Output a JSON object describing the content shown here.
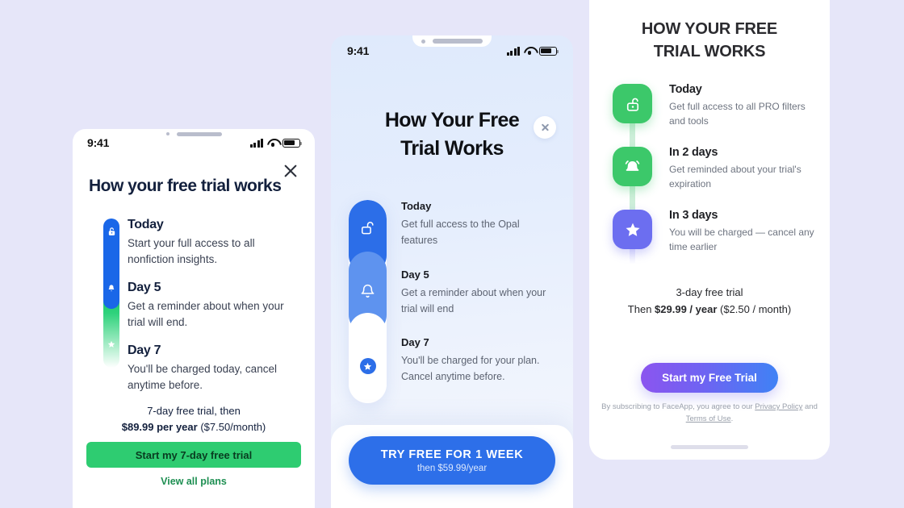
{
  "background_color": "#e6e6f9",
  "panel1": {
    "name": "blinkist-style-trial-screen",
    "status_bar": {
      "time": "9:41",
      "icons": [
        "signal-icon",
        "wifi-icon",
        "battery-icon"
      ]
    },
    "close_icon": "close-icon",
    "title": "How your free trial works",
    "accent_color": "#1a67e8",
    "success_color": "#2ecc71",
    "steps": [
      {
        "icon": "unlock-icon",
        "title": "Today",
        "desc": "Start your full access to all nonfiction insights."
      },
      {
        "icon": "bell-icon",
        "title": "Day 5",
        "desc": "Get a reminder about when your trial will end."
      },
      {
        "icon": "star-icon",
        "title": "Day 7",
        "desc": "You'll be charged today, cancel anytime before."
      }
    ],
    "price_line1": "7-day free trial, then",
    "price_amount": "$89.99 per year",
    "price_suffix": " ($7.50/month)",
    "cta_label": "Start my 7-day free trial",
    "secondary_link": "View all plans"
  },
  "panel2": {
    "name": "opal-style-trial-screen",
    "status_bar": {
      "time": "9:41",
      "icons": [
        "signal-icon",
        "wifi-icon",
        "battery-icon"
      ]
    },
    "close_icon": "close-icon",
    "title_line1": "How Your Free",
    "title_line2": "Trial Works",
    "accent_color": "#2d6fe9",
    "steps": [
      {
        "icon": "unlock-icon",
        "title": "Today",
        "desc": "Get full access to the Opal features"
      },
      {
        "icon": "bell-icon",
        "title": "Day 5",
        "desc": "Get a reminder about when your trial will end"
      },
      {
        "icon": "star-icon",
        "title": "Day 7",
        "desc": "You'll be charged for your plan. Cancel anytime before."
      }
    ],
    "cta_label": "TRY FREE FOR 1 WEEK",
    "cta_subtitle": "then $59.99/year"
  },
  "panel3": {
    "name": "faceapp-style-trial-screen",
    "title_line1": "HOW YOUR FREE",
    "title_line2": "TRIAL WORKS",
    "green_color": "#3cc86a",
    "purple_color": "#6c6ef0",
    "steps": [
      {
        "icon": "unlock-icon",
        "title": "Today",
        "desc": "Get full access to all PRO filters and tools"
      },
      {
        "icon": "bell-icon",
        "title": "In 2 days",
        "desc": "Get reminded about your trial's expiration"
      },
      {
        "icon": "star-icon",
        "title": "In 3 days",
        "desc": "You will be charged — cancel any time earlier"
      }
    ],
    "price_line1": "3-day free trial",
    "price_prefix": "Then ",
    "price_amount": "$29.99 / year",
    "price_suffix": " ($2.50 / month)",
    "cta_label": "Start my Free Trial",
    "legal_prefix": "By subscribing to FaceApp, you agree to our ",
    "legal_link1": "Privacy Policy",
    "legal_mid": " and ",
    "legal_link2": "Terms of Use",
    "legal_suffix": "."
  }
}
